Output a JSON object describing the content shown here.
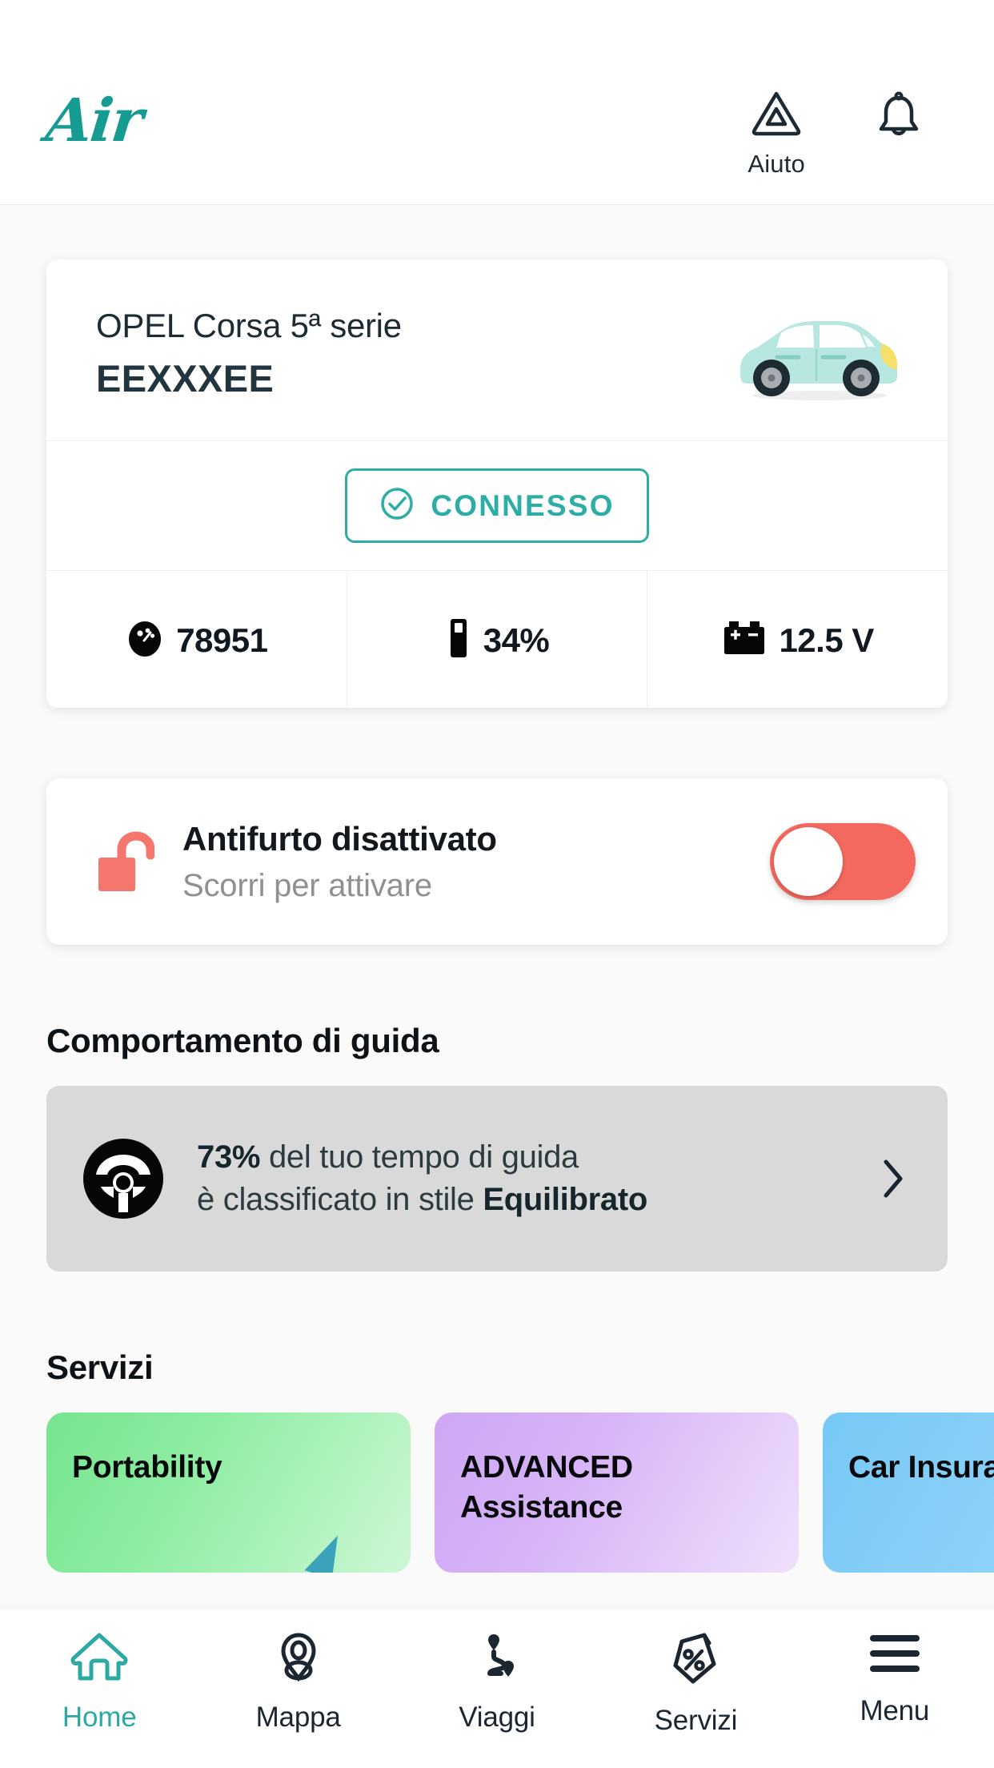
{
  "brand": {
    "logo_text": "Air",
    "accent": "#2CADA5",
    "danger": "#F4695F"
  },
  "header": {
    "help": {
      "label": "Aiuto",
      "icon": "warning-triangle-icon"
    },
    "notifications": {
      "icon": "bell-icon"
    }
  },
  "vehicle": {
    "model": "OPEL Corsa 5ª serie",
    "plate": "EEXXXEE",
    "image": "car-side-illustration",
    "connection": {
      "label": "CONNESSO",
      "icon": "check-circle-icon",
      "color": "#2CADA5"
    },
    "stats": [
      {
        "icon": "odometer-icon",
        "value": "78951"
      },
      {
        "icon": "fuel-icon",
        "value": "34%"
      },
      {
        "icon": "battery-icon",
        "value": "12.5 V"
      }
    ]
  },
  "antitheft": {
    "icon": "unlocked-padlock-icon",
    "title": "Antifurto disattivato",
    "subtitle": "Scorri per attivare",
    "toggle": {
      "state": "off",
      "color": "#F4695F"
    }
  },
  "driving": {
    "section_title": "Comportamento di guida",
    "icon": "steering-wheel-icon",
    "percent": "73%",
    "line1_rest": " del tuo tempo di guida",
    "line2_prefix": "è classificato in stile ",
    "style": "Equilibrato",
    "chevron": "chevron-right-icon"
  },
  "services": {
    "section_title": "Servizi",
    "cards": [
      {
        "label": "Portability",
        "color": "#7CE894"
      },
      {
        "label": "ADVANCED\nAssistance",
        "color": "#CDA7F4"
      },
      {
        "label": "Car Insurance",
        "color": "#7BC9F5"
      }
    ]
  },
  "bottom_nav": {
    "items": [
      {
        "label": "Home",
        "icon": "home-icon",
        "active": true
      },
      {
        "label": "Mappa",
        "icon": "map-pin-icon",
        "active": false
      },
      {
        "label": "Viaggi",
        "icon": "route-icon",
        "active": false
      },
      {
        "label": "Servizi",
        "icon": "tag-percent-icon",
        "active": false
      },
      {
        "label": "Menu",
        "icon": "hamburger-icon",
        "active": false
      }
    ]
  }
}
